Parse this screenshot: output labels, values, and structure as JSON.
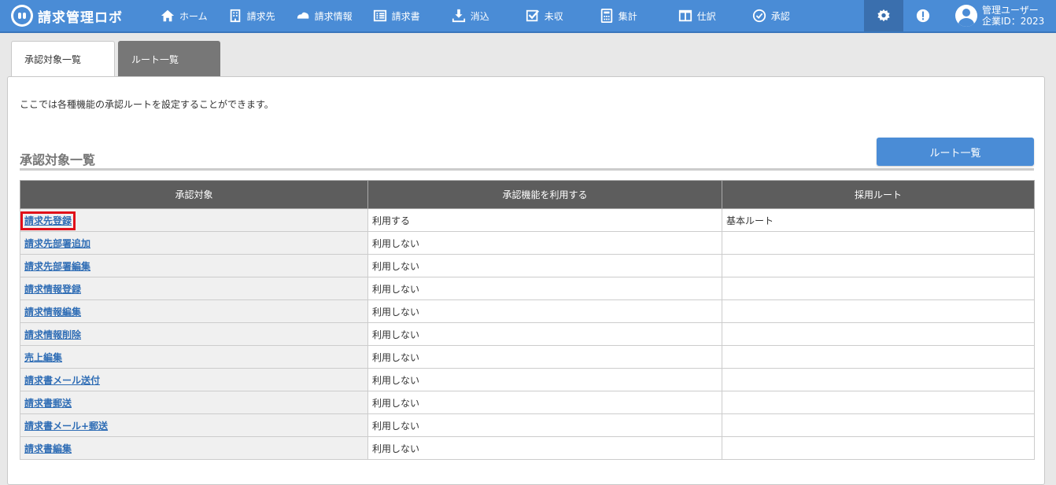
{
  "header": {
    "logo_text": "請求管理ロボ",
    "nav": [
      {
        "label": "ホーム",
        "icon": "home-icon"
      },
      {
        "label": "請求先",
        "icon": "building-icon"
      },
      {
        "label": "請求情報",
        "icon": "cloud-icon"
      },
      {
        "label": "請求書",
        "icon": "list-icon"
      },
      {
        "label": "消込",
        "icon": "download-icon"
      },
      {
        "label": "未収",
        "icon": "checkbox-icon"
      },
      {
        "label": "集計",
        "icon": "calculator-icon"
      },
      {
        "label": "仕訳",
        "icon": "columns-icon"
      },
      {
        "label": "承認",
        "icon": "check-circle-icon"
      }
    ],
    "user": {
      "name": "管理ユーザー",
      "company": "企業ID：2023"
    }
  },
  "tabs": [
    {
      "label": "承認対象一覧",
      "active": true
    },
    {
      "label": "ルート一覧",
      "active": false
    }
  ],
  "main": {
    "description": "ここでは各種機能の承認ルートを設定することができます。",
    "section_title": "承認対象一覧",
    "route_button": "ルート一覧",
    "table": {
      "headers": [
        "承認対象",
        "承認機能を利用する",
        "採用ルート"
      ],
      "rows": [
        {
          "target": "請求先登録",
          "use": "利用する",
          "route": "基本ルート"
        },
        {
          "target": "請求先部署追加",
          "use": "利用しない",
          "route": ""
        },
        {
          "target": "請求先部署編集",
          "use": "利用しない",
          "route": ""
        },
        {
          "target": "請求情報登録",
          "use": "利用しない",
          "route": ""
        },
        {
          "target": "請求情報編集",
          "use": "利用しない",
          "route": ""
        },
        {
          "target": "請求情報削除",
          "use": "利用しない",
          "route": ""
        },
        {
          "target": "売上編集",
          "use": "利用しない",
          "route": ""
        },
        {
          "target": "請求書メール送付",
          "use": "利用しない",
          "route": ""
        },
        {
          "target": "請求書郵送",
          "use": "利用しない",
          "route": ""
        },
        {
          "target": "請求書メール+郵送",
          "use": "利用しない",
          "route": ""
        },
        {
          "target": "請求書編集",
          "use": "利用しない",
          "route": ""
        }
      ]
    }
  },
  "colors": {
    "nav_bg": "#4a8cd6",
    "highlight": "#e0101a",
    "link": "#2f6db5"
  }
}
